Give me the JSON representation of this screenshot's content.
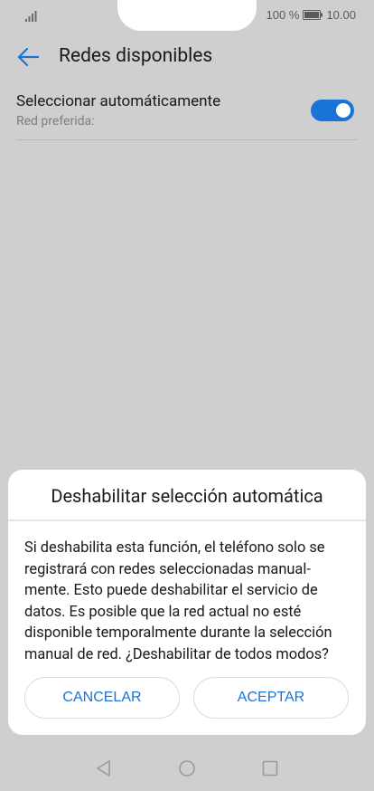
{
  "status_bar": {
    "battery_percent": "100 %",
    "time": "10.00"
  },
  "header": {
    "title": "Redes disponibles"
  },
  "settings": {
    "auto_select_label": "Seleccionar automáticamente",
    "preferred_network_label": "Red preferida:",
    "auto_select_enabled": true
  },
  "dialog": {
    "title": "Deshabilitar selección automática",
    "message": "Si deshabilita esta función, el teléfono solo se registrará con redes seleccionadas manual- mente. Esto puede deshabilitar el servicio de datos. Es posible que la red actual no esté disponible temporalmente durante la selección manual de red. ¿Deshabilitar de todos modos?",
    "cancel_label": "CANCELAR",
    "accept_label": "ACEPTAR"
  },
  "colors": {
    "accent": "#1a73d9",
    "scrim_background": "#cfcfcf"
  },
  "icons": {
    "signal": "signal-icon",
    "battery": "battery-icon",
    "back": "back-arrow-icon",
    "nav_back": "triangle-back-icon",
    "nav_home": "circle-home-icon",
    "nav_recents": "square-recents-icon"
  }
}
